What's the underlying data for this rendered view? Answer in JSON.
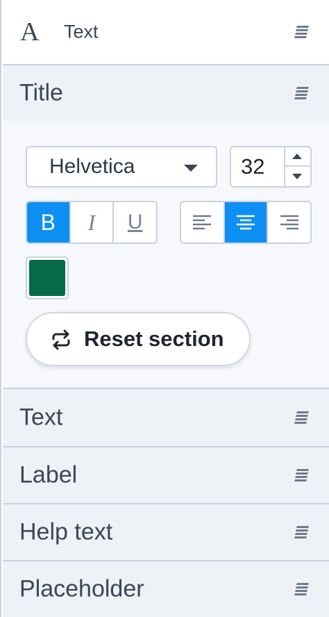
{
  "panel": {
    "header": {
      "label": "Text",
      "icon": "font-type-icon"
    },
    "sections": [
      {
        "label": "Title",
        "expanded": true
      },
      {
        "label": "Text"
      },
      {
        "label": "Label"
      },
      {
        "label": "Help text"
      },
      {
        "label": "Placeholder"
      }
    ]
  },
  "title_editor": {
    "font_family": "Helvetica",
    "font_size": "32",
    "style_buttons": {
      "bold": "B",
      "italic": "I",
      "underline": "U",
      "active": "bold"
    },
    "alignment": {
      "active": "center",
      "options": [
        "left",
        "center",
        "right"
      ]
    },
    "color": "#066b46",
    "reset_label": "Reset section"
  },
  "colors": {
    "accent": "#0d8ff3",
    "border": "#c9d2de",
    "section_bg": "#eef1f6",
    "editor_bg": "#f6f8fb"
  }
}
